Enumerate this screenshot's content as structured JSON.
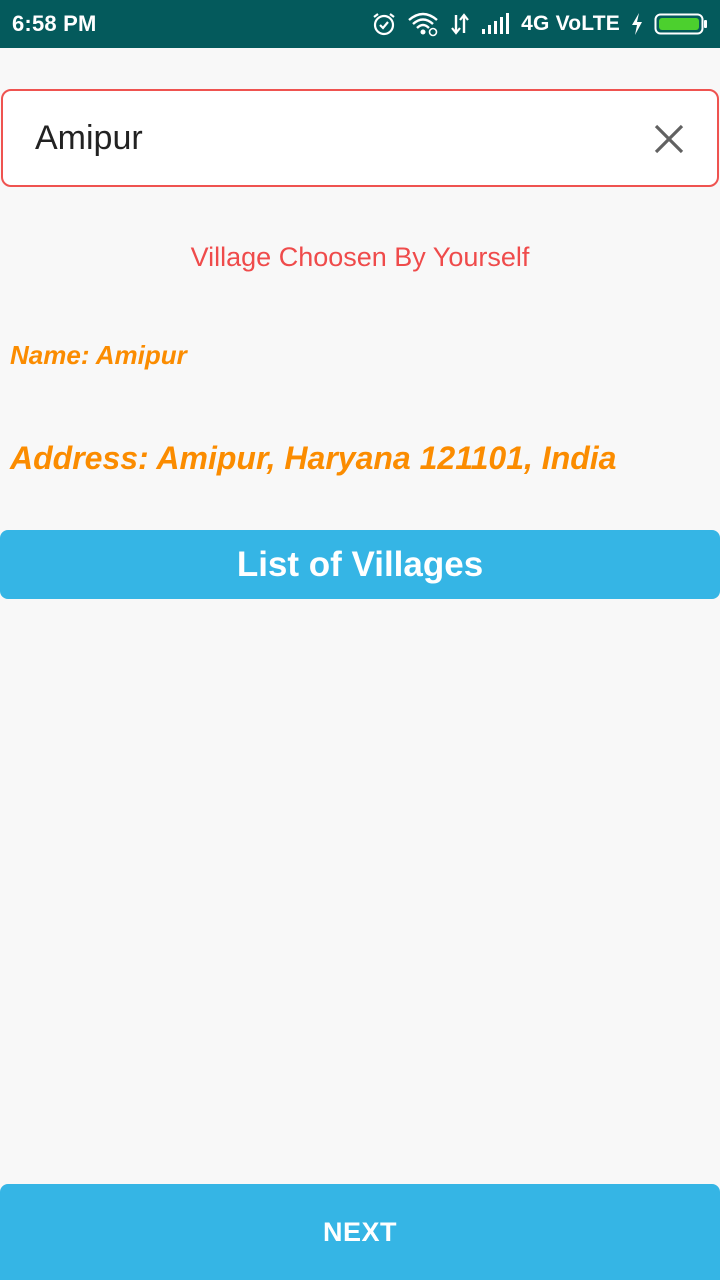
{
  "status_bar": {
    "time": "6:58 PM",
    "network": "4G VoLTE",
    "icons": [
      "alarm-icon",
      "wifi-icon",
      "data-arrows-icon",
      "signal-icon",
      "charging-icon",
      "battery-icon"
    ]
  },
  "search": {
    "value": "Amipur",
    "clear_icon": "close-icon"
  },
  "selection": {
    "caption": "Village Choosen By Yourself",
    "name": "Name: Amipur",
    "address": "Address: Amipur, Haryana 121101, India"
  },
  "buttons": {
    "list_label": "List of Villages",
    "next_label": "NEXT"
  },
  "colors": {
    "status_bar": "#045a5c",
    "accent_red": "#ef4b4b",
    "accent_orange": "#fb8c00",
    "button_blue": "#35b5e5",
    "battery_green": "#4cd02e"
  }
}
